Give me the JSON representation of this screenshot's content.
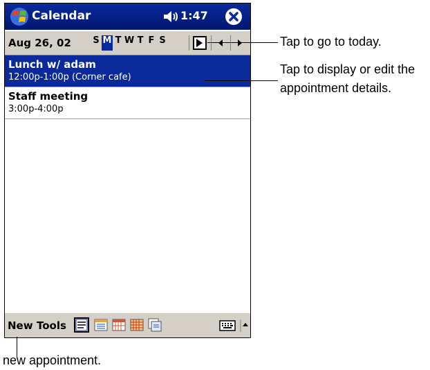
{
  "titlebar": {
    "app_title": "Calendar",
    "clock": "1:47"
  },
  "datebar": {
    "date": "Aug 26, 02",
    "weekdays": [
      "S",
      "M",
      "T",
      "W",
      "T",
      "F",
      "S"
    ],
    "selected_weekday_index": 1
  },
  "appointments": [
    {
      "title": "Lunch w/ adam",
      "detail": "12:00p-1:00p (Corner cafe)"
    },
    {
      "title": "Staff meeting",
      "detail": "3:00p-4:00p"
    }
  ],
  "commandbar": {
    "new_label": "New",
    "tools_label": "Tools"
  },
  "callouts": {
    "today": "Tap to go to today.",
    "details_line1": "Tap to display or edit the",
    "details_line2": "appointment details.",
    "new": "new appointment."
  },
  "colors": {
    "title_bar": "#0a2a9c",
    "selection": "#0a2a9c",
    "bar_gray": "#d4d0c8"
  },
  "icons": [
    "start-icon",
    "volume-icon",
    "close-icon",
    "go-to-today-icon",
    "prev-icon",
    "next-icon",
    "agenda-view-icon",
    "day-view-icon",
    "week-view-icon",
    "month-view-icon",
    "year-view-icon",
    "keyboard-icon",
    "input-arrow-icon"
  ]
}
